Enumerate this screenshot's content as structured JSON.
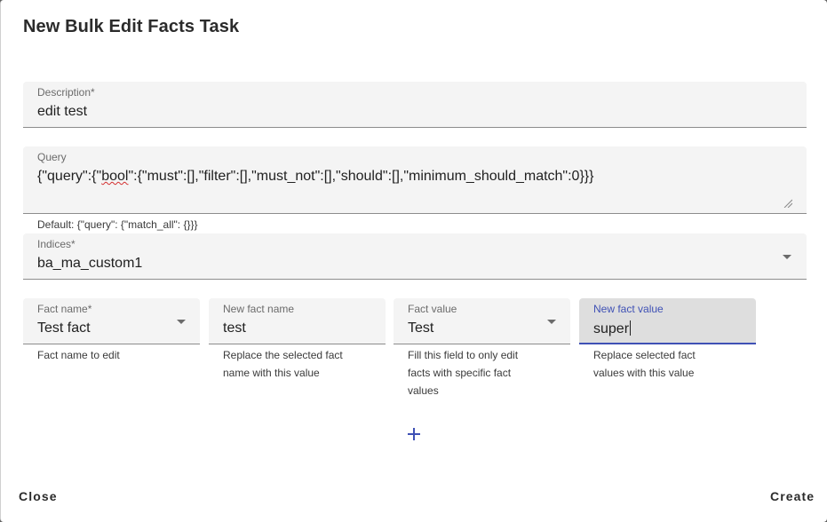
{
  "dialog": {
    "title": "New Bulk Edit Facts Task"
  },
  "description": {
    "label": "Description*",
    "value": "edit test"
  },
  "query": {
    "label": "Query",
    "value_pre": "{\"query\":{\"",
    "value_misspelled": "bool",
    "value_post": "\":{\"must\":[],\"filter\":[],\"must_not\":[],\"should\":[],\"minimum_should_match\":0}}}",
    "helper": "Default: {\"query\": {\"match_all\": {}}}"
  },
  "indices": {
    "label": "Indices*",
    "value": "ba_ma_custom1",
    "icon": "dropdown-arrow-icon"
  },
  "fact_name": {
    "label": "Fact name*",
    "value": "Test fact",
    "helper": "Fact name to edit"
  },
  "new_fact_name": {
    "label": "New fact name",
    "value": "test",
    "helper_line1": "Replace the selected fact",
    "helper_line2": "name with this value"
  },
  "fact_value": {
    "label": "Fact value",
    "value": "Test",
    "helper_line1": "Fill this field to only edit",
    "helper_line2": "facts with specific fact",
    "helper_line3": "values"
  },
  "new_fact_value": {
    "label": "New fact value",
    "value": "super",
    "helper_line1": "Replace selected fact",
    "helper_line2": "values with this value"
  },
  "add_button": {
    "icon": "plus-icon",
    "color": "#3f51b5"
  },
  "actions": {
    "close_label": "Close",
    "create_label": "Create"
  },
  "colors": {
    "accent": "#3f51b5",
    "field_bg": "#f4f4f4",
    "focused_bg": "#dedede"
  }
}
